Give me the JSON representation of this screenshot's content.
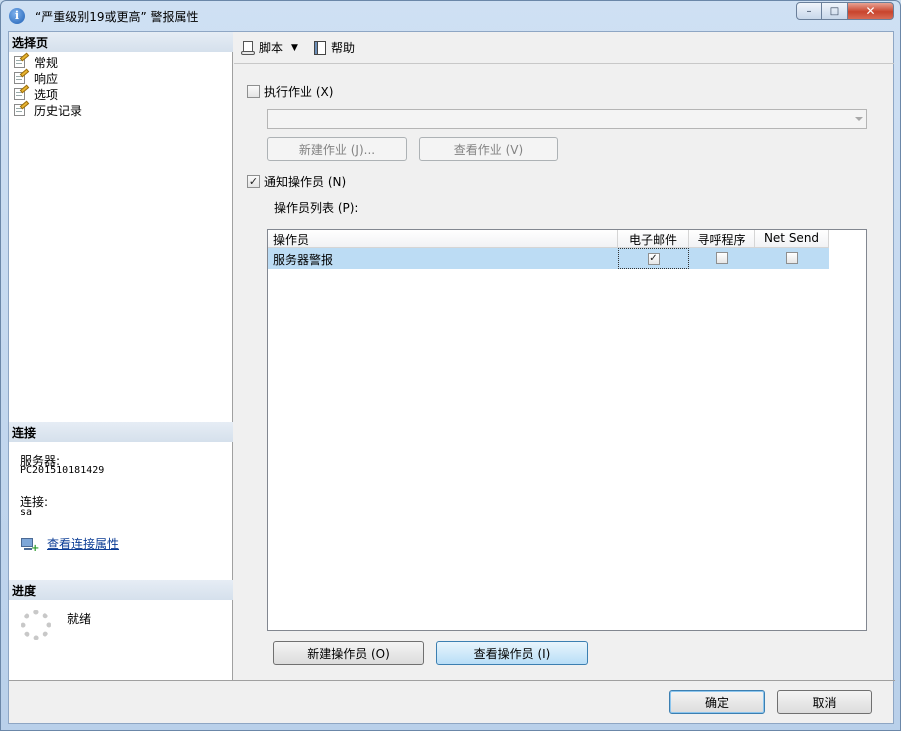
{
  "window": {
    "title": "“严重级别19或更高” 警报属性",
    "minimize": "–",
    "maximize": "□",
    "close": "✕",
    "icon": "info-icon"
  },
  "left_pane": {
    "select_page_header": "选择页",
    "pages": [
      {
        "label": "常规",
        "icon": "page-edit-icon"
      },
      {
        "label": "响应",
        "icon": "page-edit-icon"
      },
      {
        "label": "选项",
        "icon": "page-edit-icon"
      },
      {
        "label": "历史记录",
        "icon": "page-edit-icon"
      }
    ],
    "connection_header": "连接",
    "server_label": "服务器:",
    "server_value": "PC201510181429",
    "connection_label": "连接:",
    "connection_value": "sa",
    "view_connection_link": "查看连接属性",
    "progress_header": "进度",
    "progress_status": "就绪"
  },
  "toolbar": {
    "script_label": "脚本",
    "help_label": "帮助"
  },
  "response": {
    "execute_job_label": "执行作业 (X)",
    "execute_job_checked": false,
    "job_combo_value": "",
    "new_job_button": "新建作业 (J)...",
    "view_job_button": "查看作业 (V)",
    "notify_operators_label": "通知操作员 (N)",
    "notify_operators_checked": true,
    "operator_list_label": "操作员列表 (P):",
    "grid": {
      "columns": [
        "操作员",
        "电子邮件",
        "寻呼程序",
        "Net Send"
      ],
      "rows": [
        {
          "operator": "服务器警报",
          "email": true,
          "pager": false,
          "net_send": false
        }
      ]
    },
    "new_operator_button": "新建操作员 (O)",
    "view_operator_button": "查看操作员 (I)"
  },
  "footer": {
    "ok_button": "确定",
    "cancel_button": "取消"
  },
  "colors": {
    "selected_row": "#bcdcf4",
    "link": "#0b3c95",
    "header_band": "#d5e0ec"
  }
}
